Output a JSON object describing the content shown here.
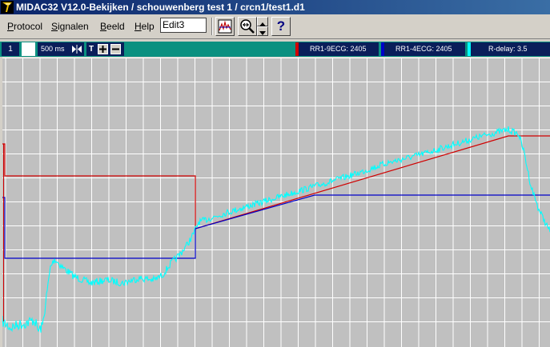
{
  "window": {
    "title": "MIDAC32 V12.0-Bekijken / schouwenberg test 1 / crcn1/test1.d1"
  },
  "menu": {
    "items": [
      {
        "label": "Protocol",
        "accel": "P"
      },
      {
        "label": "Signalen",
        "accel": "S"
      },
      {
        "label": "Beeld",
        "accel": "B"
      },
      {
        "label": "Help",
        "accel": "H"
      }
    ],
    "edit_value": "Edit3"
  },
  "toolbar": {
    "help_glyph": "?"
  },
  "channel_bar": {
    "channel_number": "1",
    "timebase": "500 ms",
    "t_label": "T",
    "cursor1_label": "RR1-9ECG: 2405",
    "cursor2_label": "RR1-4ECG: 2405",
    "cursor3_label": "R-delay: 3.5"
  },
  "colors": {
    "signal": "#00ffff",
    "cursor1": "#d00000",
    "cursor2": "#0000c8",
    "grid": "#ffffff",
    "plot_background": "#c0c0c0"
  },
  "icons": [
    "app-icon",
    "compress-icon",
    "zoom-in-icon",
    "zoom-out-icon",
    "spectrum-icon",
    "zoom-search-icon",
    "spin-up-icon",
    "spin-down-icon",
    "help-icon"
  ]
}
